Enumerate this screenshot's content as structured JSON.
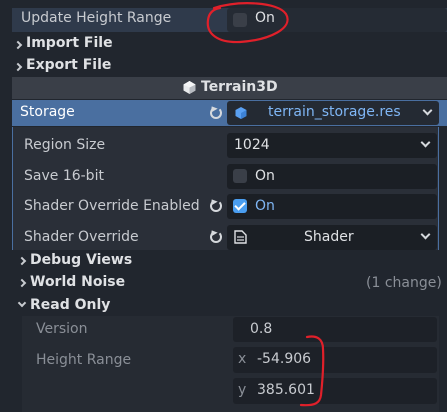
{
  "top": {
    "update_height_range_label": "Update Height Range",
    "update_height_range_value": "On",
    "import_file_label": "Import File",
    "export_file_label": "Export File"
  },
  "section_header": {
    "title": "Terrain3D"
  },
  "storage": {
    "label": "Storage",
    "resource": "terrain_storage.res"
  },
  "properties": {
    "region_size_label": "Region Size",
    "region_size_value": "1024",
    "save_16bit_label": "Save 16-bit",
    "save_16bit_value": "On",
    "shader_override_enabled_label": "Shader Override Enabled",
    "shader_override_enabled_value": "On",
    "shader_override_label": "Shader Override",
    "shader_override_value": "Shader"
  },
  "groups": {
    "debug_views": "Debug Views",
    "world_noise": "World Noise",
    "world_noise_changes": "(1 change)",
    "read_only": "Read Only"
  },
  "read_only": {
    "version_label": "Version",
    "version_value": "0.8",
    "height_range_label": "Height Range",
    "x_axis": "x",
    "x_value": "-54.906",
    "y_axis": "y",
    "y_value": "385.601"
  },
  "colors": {
    "accent": "#4a9ef0",
    "storage_row": "#4a6fa0",
    "annotation": "#e0202a"
  }
}
